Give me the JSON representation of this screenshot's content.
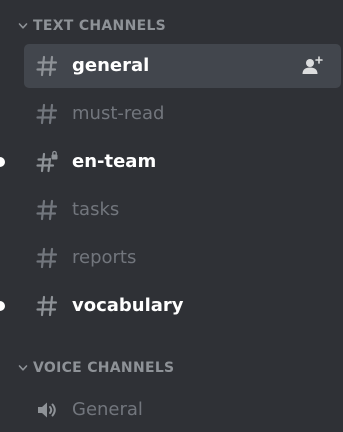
{
  "colors": {
    "sidebar_bg": "#2f3136",
    "selected_bg": "#42464d",
    "category_text": "#8e9297",
    "muted_text": "#72767d",
    "active_text": "#ffffff"
  },
  "text_category": {
    "label": "TEXT CHANNELS",
    "icon": "chevron-down-icon"
  },
  "text_channels": [
    {
      "name": "general",
      "icon": "hashtag-icon",
      "state": "selected",
      "action_icon": "add-member-icon"
    },
    {
      "name": "must-read",
      "icon": "hashtag-icon",
      "state": "muted"
    },
    {
      "name": "en-team",
      "icon": "private-hashtag-icon",
      "state": "unread"
    },
    {
      "name": "tasks",
      "icon": "hashtag-icon",
      "state": "muted"
    },
    {
      "name": "reports",
      "icon": "hashtag-icon",
      "state": "muted"
    },
    {
      "name": "vocabulary",
      "icon": "hashtag-icon",
      "state": "unread"
    }
  ],
  "voice_category": {
    "label": "VOICE CHANNELS",
    "icon": "chevron-down-icon"
  },
  "voice_channels": [
    {
      "name": "General",
      "icon": "speaker-icon",
      "state": "muted"
    }
  ]
}
